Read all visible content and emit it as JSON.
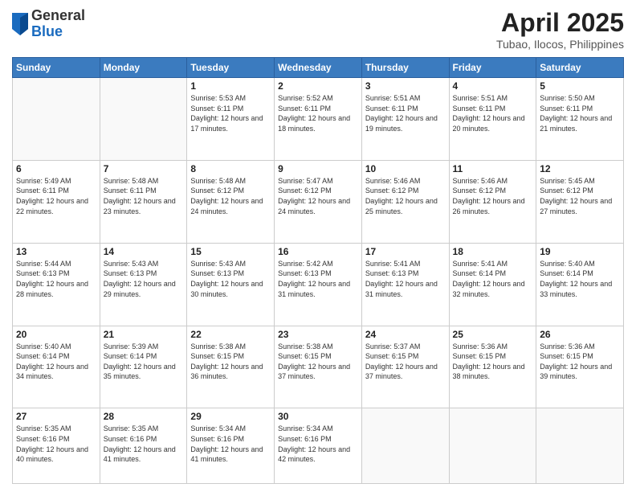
{
  "logo": {
    "general": "General",
    "blue": "Blue"
  },
  "header": {
    "title": "April 2025",
    "subtitle": "Tubao, Ilocos, Philippines"
  },
  "weekdays": [
    "Sunday",
    "Monday",
    "Tuesday",
    "Wednesday",
    "Thursday",
    "Friday",
    "Saturday"
  ],
  "days": [
    {
      "date": "",
      "sunrise": "",
      "sunset": "",
      "daylight": ""
    },
    {
      "date": "",
      "sunrise": "",
      "sunset": "",
      "daylight": ""
    },
    {
      "date": "1",
      "sunrise": "Sunrise: 5:53 AM",
      "sunset": "Sunset: 6:11 PM",
      "daylight": "Daylight: 12 hours and 17 minutes."
    },
    {
      "date": "2",
      "sunrise": "Sunrise: 5:52 AM",
      "sunset": "Sunset: 6:11 PM",
      "daylight": "Daylight: 12 hours and 18 minutes."
    },
    {
      "date": "3",
      "sunrise": "Sunrise: 5:51 AM",
      "sunset": "Sunset: 6:11 PM",
      "daylight": "Daylight: 12 hours and 19 minutes."
    },
    {
      "date": "4",
      "sunrise": "Sunrise: 5:51 AM",
      "sunset": "Sunset: 6:11 PM",
      "daylight": "Daylight: 12 hours and 20 minutes."
    },
    {
      "date": "5",
      "sunrise": "Sunrise: 5:50 AM",
      "sunset": "Sunset: 6:11 PM",
      "daylight": "Daylight: 12 hours and 21 minutes."
    },
    {
      "date": "6",
      "sunrise": "Sunrise: 5:49 AM",
      "sunset": "Sunset: 6:11 PM",
      "daylight": "Daylight: 12 hours and 22 minutes."
    },
    {
      "date": "7",
      "sunrise": "Sunrise: 5:48 AM",
      "sunset": "Sunset: 6:11 PM",
      "daylight": "Daylight: 12 hours and 23 minutes."
    },
    {
      "date": "8",
      "sunrise": "Sunrise: 5:48 AM",
      "sunset": "Sunset: 6:12 PM",
      "daylight": "Daylight: 12 hours and 24 minutes."
    },
    {
      "date": "9",
      "sunrise": "Sunrise: 5:47 AM",
      "sunset": "Sunset: 6:12 PM",
      "daylight": "Daylight: 12 hours and 24 minutes."
    },
    {
      "date": "10",
      "sunrise": "Sunrise: 5:46 AM",
      "sunset": "Sunset: 6:12 PM",
      "daylight": "Daylight: 12 hours and 25 minutes."
    },
    {
      "date": "11",
      "sunrise": "Sunrise: 5:46 AM",
      "sunset": "Sunset: 6:12 PM",
      "daylight": "Daylight: 12 hours and 26 minutes."
    },
    {
      "date": "12",
      "sunrise": "Sunrise: 5:45 AM",
      "sunset": "Sunset: 6:12 PM",
      "daylight": "Daylight: 12 hours and 27 minutes."
    },
    {
      "date": "13",
      "sunrise": "Sunrise: 5:44 AM",
      "sunset": "Sunset: 6:13 PM",
      "daylight": "Daylight: 12 hours and 28 minutes."
    },
    {
      "date": "14",
      "sunrise": "Sunrise: 5:43 AM",
      "sunset": "Sunset: 6:13 PM",
      "daylight": "Daylight: 12 hours and 29 minutes."
    },
    {
      "date": "15",
      "sunrise": "Sunrise: 5:43 AM",
      "sunset": "Sunset: 6:13 PM",
      "daylight": "Daylight: 12 hours and 30 minutes."
    },
    {
      "date": "16",
      "sunrise": "Sunrise: 5:42 AM",
      "sunset": "Sunset: 6:13 PM",
      "daylight": "Daylight: 12 hours and 31 minutes."
    },
    {
      "date": "17",
      "sunrise": "Sunrise: 5:41 AM",
      "sunset": "Sunset: 6:13 PM",
      "daylight": "Daylight: 12 hours and 31 minutes."
    },
    {
      "date": "18",
      "sunrise": "Sunrise: 5:41 AM",
      "sunset": "Sunset: 6:14 PM",
      "daylight": "Daylight: 12 hours and 32 minutes."
    },
    {
      "date": "19",
      "sunrise": "Sunrise: 5:40 AM",
      "sunset": "Sunset: 6:14 PM",
      "daylight": "Daylight: 12 hours and 33 minutes."
    },
    {
      "date": "20",
      "sunrise": "Sunrise: 5:40 AM",
      "sunset": "Sunset: 6:14 PM",
      "daylight": "Daylight: 12 hours and 34 minutes."
    },
    {
      "date": "21",
      "sunrise": "Sunrise: 5:39 AM",
      "sunset": "Sunset: 6:14 PM",
      "daylight": "Daylight: 12 hours and 35 minutes."
    },
    {
      "date": "22",
      "sunrise": "Sunrise: 5:38 AM",
      "sunset": "Sunset: 6:15 PM",
      "daylight": "Daylight: 12 hours and 36 minutes."
    },
    {
      "date": "23",
      "sunrise": "Sunrise: 5:38 AM",
      "sunset": "Sunset: 6:15 PM",
      "daylight": "Daylight: 12 hours and 37 minutes."
    },
    {
      "date": "24",
      "sunrise": "Sunrise: 5:37 AM",
      "sunset": "Sunset: 6:15 PM",
      "daylight": "Daylight: 12 hours and 37 minutes."
    },
    {
      "date": "25",
      "sunrise": "Sunrise: 5:36 AM",
      "sunset": "Sunset: 6:15 PM",
      "daylight": "Daylight: 12 hours and 38 minutes."
    },
    {
      "date": "26",
      "sunrise": "Sunrise: 5:36 AM",
      "sunset": "Sunset: 6:15 PM",
      "daylight": "Daylight: 12 hours and 39 minutes."
    },
    {
      "date": "27",
      "sunrise": "Sunrise: 5:35 AM",
      "sunset": "Sunset: 6:16 PM",
      "daylight": "Daylight: 12 hours and 40 minutes."
    },
    {
      "date": "28",
      "sunrise": "Sunrise: 5:35 AM",
      "sunset": "Sunset: 6:16 PM",
      "daylight": "Daylight: 12 hours and 41 minutes."
    },
    {
      "date": "29",
      "sunrise": "Sunrise: 5:34 AM",
      "sunset": "Sunset: 6:16 PM",
      "daylight": "Daylight: 12 hours and 41 minutes."
    },
    {
      "date": "30",
      "sunrise": "Sunrise: 5:34 AM",
      "sunset": "Sunset: 6:16 PM",
      "daylight": "Daylight: 12 hours and 42 minutes."
    },
    {
      "date": "",
      "sunrise": "",
      "sunset": "",
      "daylight": ""
    },
    {
      "date": "",
      "sunrise": "",
      "sunset": "",
      "daylight": ""
    },
    {
      "date": "",
      "sunrise": "",
      "sunset": "",
      "daylight": ""
    }
  ]
}
